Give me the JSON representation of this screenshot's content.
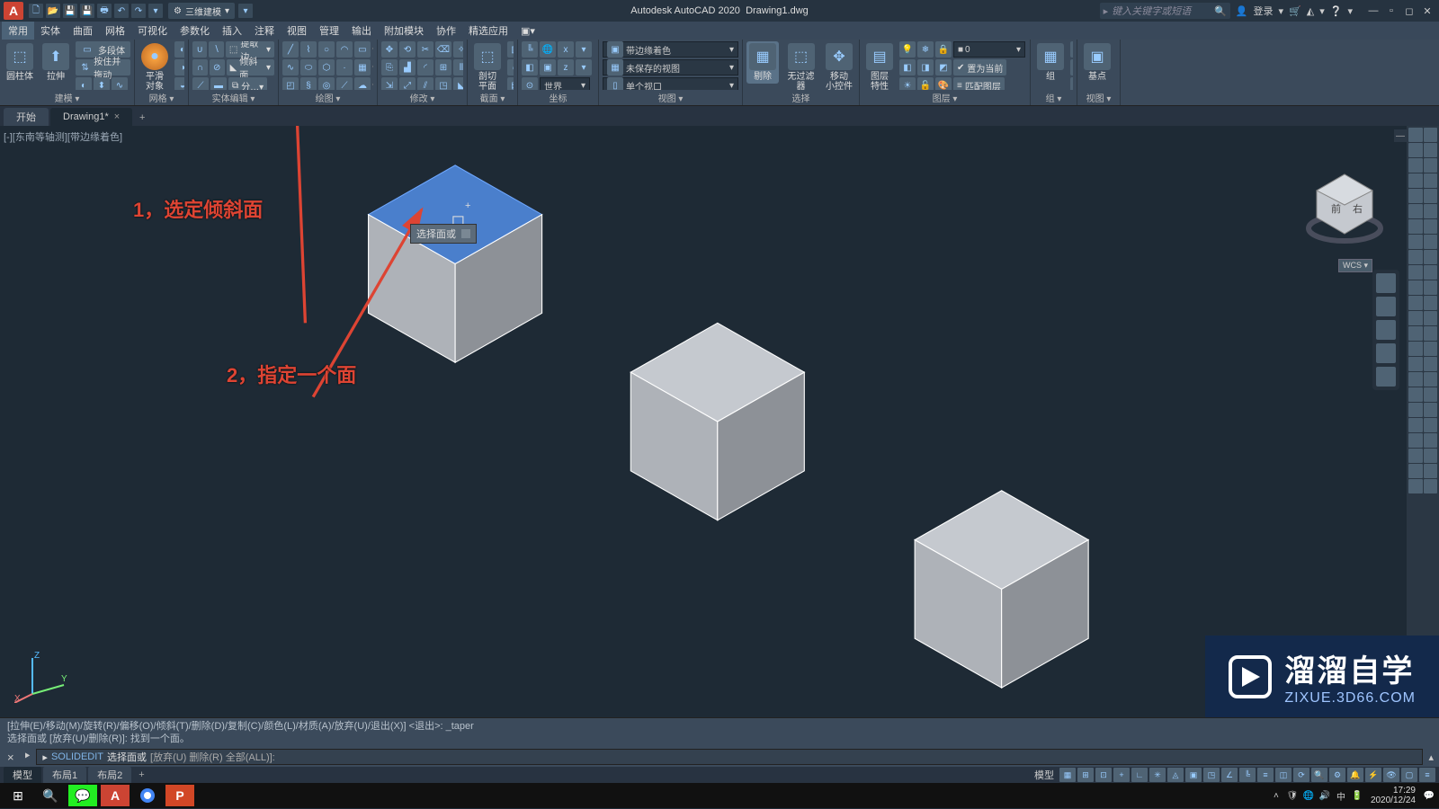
{
  "title_app": "Autodesk AutoCAD 2020",
  "title_file": "Drawing1.dwg",
  "workspace_dd": "三维建模",
  "search_placeholder": "键入关键字或短语",
  "login_label": "登录",
  "menus": [
    "常用",
    "实体",
    "曲面",
    "网格",
    "可视化",
    "参数化",
    "插入",
    "注释",
    "视图",
    "管理",
    "输出",
    "附加模块",
    "协作",
    "精选应用"
  ],
  "panels": {
    "modeling_label": "建模 ▾",
    "btn_cylinder": "圆柱体",
    "btn_extrude": "拉伸",
    "btn_polysolid": "多段体",
    "btn_presspull": "按住并拖动",
    "mesh_label": "网格 ▾",
    "btn_smooth": "平滑\n对象",
    "solid_edit_label": "实体编辑 ▾",
    "btn_extract_edges": "提取边",
    "btn_taper_face": "倾斜面",
    "draw_label": "绘图 ▾",
    "modify_label": "修改 ▾",
    "section_label": "截面 ▾",
    "btn_section": "剖切\n平面",
    "coord_label": "坐标",
    "dd_visual_style": "带边缘着色",
    "dd_view_saved": "未保存的视图",
    "dd_world": "世界",
    "dd_single_viewport": "单个视口",
    "view_label": "视图 ▾",
    "sel_label": "选择",
    "btn_remove": "剔除",
    "btn_nofilter": "无过滤器",
    "btn_move_gizmo": "移动\n小控件",
    "layer_label": "图层 ▾",
    "btn_layer_props": "图层\n特性",
    "dd_layer_zero": "0",
    "btn_set_current": "置为当前",
    "btn_match_layer": "匹配图层",
    "group_label": "组 ▾",
    "btn_group": "组",
    "view2_label": "视图 ▾",
    "btn_base": "基点"
  },
  "tabs": {
    "start": "开始",
    "drawing": "Drawing1*"
  },
  "view_label": "[-][东南等轴测][带边缘着色]",
  "wcs": "WCS",
  "tooltip_text": "选择面或",
  "annotation1": "1，选定倾斜面",
  "annotation2": "2，指定一个面",
  "watermark_main": "溜溜自学",
  "watermark_sub": "ZIXUE.3D66.COM",
  "cmd_history1": "[拉伸(E)/移动(M)/旋转(R)/偏移(O)/倾斜(T)/删除(D)/复制(C)/颜色(L)/材质(A)/放弃(U)/退出(X)] <退出>: _taper",
  "cmd_history2": "选择面或 [放弃(U)/删除(R)]: 找到一个面。",
  "cmd_prompt_cmd": "SOLIDEDIT",
  "cmd_prompt_text": "选择面或",
  "cmd_prompt_opts": "[放弃(U) 删除(R) 全部(ALL)]:",
  "btabs": {
    "model": "模型",
    "layout1": "布局1",
    "layout2": "布局2"
  },
  "status_model": "模型",
  "time": "17:29",
  "date": "2020/12/24"
}
